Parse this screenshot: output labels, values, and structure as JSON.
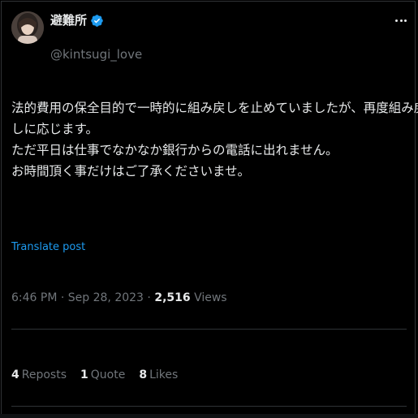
{
  "author": {
    "display_name": "避難所",
    "handle": "@kintsugi_love",
    "verified": true,
    "avatar_icon": "avatar-photo"
  },
  "tweet": {
    "lines": [
      "法的費用の保全目的で一時的に組み戻しを止めていましたが、再度組み戻",
      "しに応じます。",
      "ただ平日は仕事でなかなか銀行からの電話に出れません。",
      "お時間頂く事だけはご了承くださいませ。"
    ]
  },
  "translate_label": "Translate post",
  "meta": {
    "time": "6:46 PM",
    "separator": " · ",
    "date": "Sep 28, 2023",
    "views_count": "2,516",
    "views_label": "Views"
  },
  "stats": {
    "reposts_count": "4",
    "reposts_label": "Reposts",
    "quotes_count": "1",
    "quotes_label": "Quote",
    "likes_count": "8",
    "likes_label": "Likes"
  },
  "colors": {
    "background": "#000000",
    "text": "#e7e9ea",
    "muted": "#71767b",
    "link": "#1d9bf0",
    "verified": "#1d9bf0",
    "divider": "#2f3336"
  }
}
